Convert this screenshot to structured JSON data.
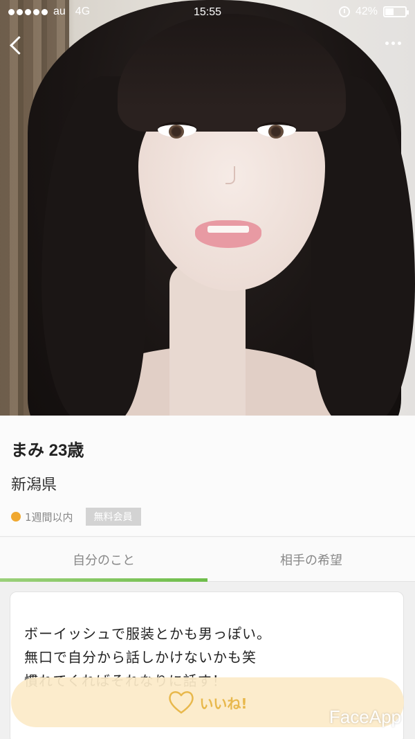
{
  "status_bar": {
    "carrier": "au",
    "network": "4G",
    "time": "15:55",
    "battery_percent": "42%",
    "battery_level": 0.42
  },
  "nav": {
    "back_icon": "chevron-left-icon",
    "more_icon": "more-dots-icon"
  },
  "profile": {
    "name_age": "まみ 23歳",
    "prefecture": "新潟県",
    "last_login": "1週間以内",
    "member_type": "無料会員",
    "status_dot_color": "#f0a830"
  },
  "tabs": [
    {
      "label": "自分のこと",
      "active": true
    },
    {
      "label": "相手の希望",
      "active": false
    }
  ],
  "bio": {
    "lines": [
      "ボーイッシュで服装とかも男っぽい。",
      "無口で自分から話しかけないかも笑",
      "慣れてくればそれなりに話す！"
    ]
  },
  "like_button": {
    "label": "いいね!",
    "icon": "heart-icon",
    "color": "#e8b84c"
  },
  "watermark": "FaceApp"
}
